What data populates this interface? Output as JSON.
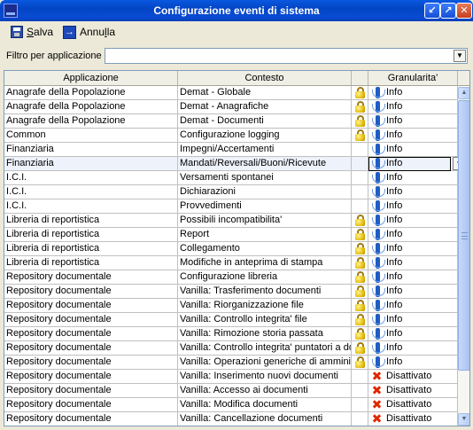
{
  "window": {
    "title": "Configurazione eventi di sistema"
  },
  "toolbar": {
    "save_label": "Salva",
    "cancel_label": "Annulla"
  },
  "filter": {
    "label": "Filtro per applicazione",
    "value": ""
  },
  "grid": {
    "columns": [
      "Applicazione",
      "Contesto",
      "",
      "Granularita'"
    ],
    "selected_row": 5,
    "rows": [
      {
        "app": "Anagrafe della Popolazione",
        "ctx": "Demat - Globale",
        "lock": true,
        "icon": "info",
        "gran": "Info"
      },
      {
        "app": "Anagrafe della Popolazione",
        "ctx": "Demat - Anagrafiche",
        "lock": true,
        "icon": "info",
        "gran": "Info"
      },
      {
        "app": "Anagrafe della Popolazione",
        "ctx": "Demat - Documenti",
        "lock": true,
        "icon": "info",
        "gran": "Info"
      },
      {
        "app": "Common",
        "ctx": "Configurazione logging",
        "lock": true,
        "icon": "info",
        "gran": "Info"
      },
      {
        "app": "Finanziaria",
        "ctx": "Impegni/Accertamenti",
        "lock": false,
        "icon": "info",
        "gran": "Info"
      },
      {
        "app": "Finanziaria",
        "ctx": "Mandati/Reversali/Buoni/Ricevute",
        "lock": false,
        "icon": "info",
        "gran": "Info"
      },
      {
        "app": "I.C.I.",
        "ctx": "Versamenti spontanei",
        "lock": false,
        "icon": "info",
        "gran": "Info"
      },
      {
        "app": "I.C.I.",
        "ctx": "Dichiarazioni",
        "lock": false,
        "icon": "info",
        "gran": "Info"
      },
      {
        "app": "I.C.I.",
        "ctx": "Provvedimenti",
        "lock": false,
        "icon": "info",
        "gran": "Info"
      },
      {
        "app": "Libreria di reportistica",
        "ctx": "Possibili incompatibilita'",
        "lock": true,
        "icon": "info",
        "gran": "Info"
      },
      {
        "app": "Libreria di reportistica",
        "ctx": "Report",
        "lock": true,
        "icon": "info",
        "gran": "Info"
      },
      {
        "app": "Libreria di reportistica",
        "ctx": "Collegamento",
        "lock": true,
        "icon": "info",
        "gran": "Info"
      },
      {
        "app": "Libreria di reportistica",
        "ctx": "Modifiche in anteprima di stampa",
        "lock": true,
        "icon": "info",
        "gran": "Info"
      },
      {
        "app": "Repository documentale",
        "ctx": "Configurazione libreria",
        "lock": true,
        "icon": "info",
        "gran": "Info"
      },
      {
        "app": "Repository documentale",
        "ctx": "Vanilla: Trasferimento documenti",
        "lock": true,
        "icon": "info",
        "gran": "Info"
      },
      {
        "app": "Repository documentale",
        "ctx": "Vanilla: Riorganizzazione file",
        "lock": true,
        "icon": "info",
        "gran": "Info"
      },
      {
        "app": "Repository documentale",
        "ctx": "Vanilla: Controllo integrita' file",
        "lock": true,
        "icon": "info",
        "gran": "Info"
      },
      {
        "app": "Repository documentale",
        "ctx": "Vanilla: Rimozione storia passata",
        "lock": true,
        "icon": "info",
        "gran": "Info"
      },
      {
        "app": "Repository documentale",
        "ctx": "Vanilla: Controllo integrita' puntatori a do",
        "lock": true,
        "icon": "info",
        "gran": "Info"
      },
      {
        "app": "Repository documentale",
        "ctx": "Vanilla: Operazioni generiche di amminist",
        "lock": true,
        "icon": "info",
        "gran": "Info"
      },
      {
        "app": "Repository documentale",
        "ctx": "Vanilla: Inserimento nuovi documenti",
        "lock": false,
        "icon": "disabled",
        "gran": "Disattivato"
      },
      {
        "app": "Repository documentale",
        "ctx": "Vanilla: Accesso ai documenti",
        "lock": false,
        "icon": "disabled",
        "gran": "Disattivato"
      },
      {
        "app": "Repository documentale",
        "ctx": "Vanilla: Modifica documenti",
        "lock": false,
        "icon": "disabled",
        "gran": "Disattivato"
      },
      {
        "app": "Repository documentale",
        "ctx": "Vanilla: Cancellazione documenti",
        "lock": false,
        "icon": "disabled",
        "gran": "Disattivato"
      }
    ]
  },
  "colors": {
    "title_bar": "#0a58e0",
    "selected_row": "#eef2fb",
    "lock": "#e0b400",
    "info_icon": "#1f5dc2",
    "disabled_icon": "#e02800"
  }
}
